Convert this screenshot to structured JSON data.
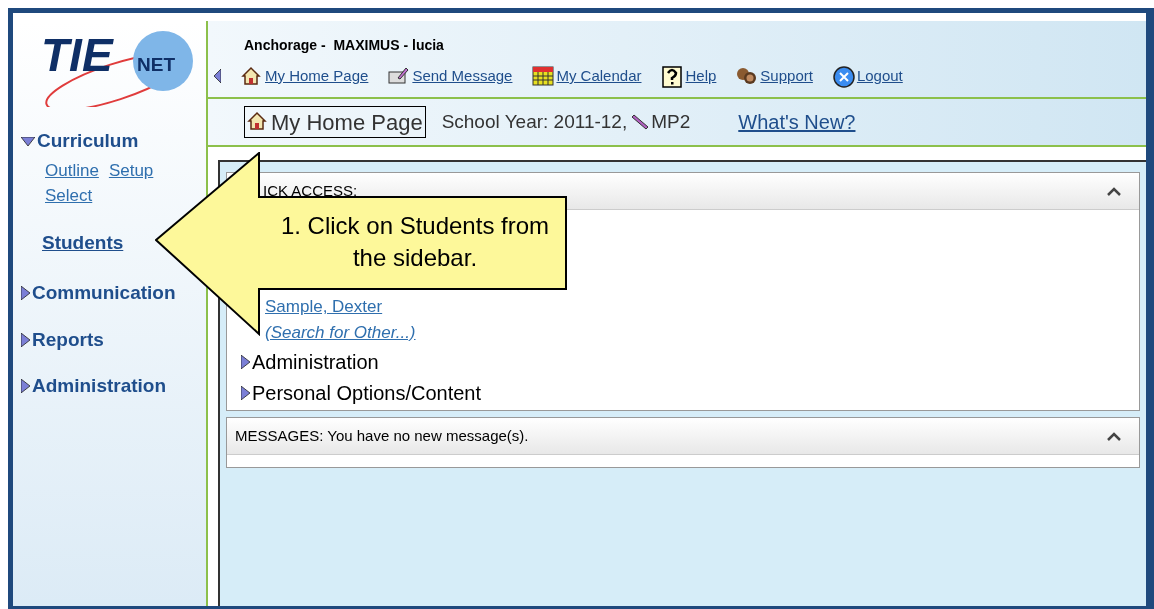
{
  "logo": {
    "word": "TIE",
    "badge": "NET"
  },
  "header": {
    "title": "Anchorage -  MAXIMUS - lucia",
    "nav": [
      {
        "kind": "home",
        "label": "My Home Page"
      },
      {
        "kind": "message",
        "label": "Send Message"
      },
      {
        "kind": "calendar",
        "label": "My Calendar"
      },
      {
        "kind": "help",
        "label": "Help"
      },
      {
        "kind": "support",
        "label": "Support"
      },
      {
        "kind": "logout",
        "label": "Logout"
      }
    ]
  },
  "subheader": {
    "page_button": "My Home Page",
    "school_year": "School Year: 2011-12,",
    "period": "MP2",
    "whats_new": "What's New?"
  },
  "sidebar": {
    "items": [
      {
        "kind": "section",
        "label": "Curriculum",
        "expanded": true,
        "children": [
          {
            "label": "Outline"
          },
          {
            "label": "Setup"
          },
          {
            "label": "Select"
          }
        ]
      },
      {
        "kind": "link",
        "label": "Students"
      },
      {
        "kind": "section",
        "label": "Communication",
        "expanded": false
      },
      {
        "kind": "section",
        "label": "Reports",
        "expanded": false
      },
      {
        "kind": "section",
        "label": "Administration",
        "expanded": false
      }
    ]
  },
  "quick_access": {
    "title": "ICK ACCESS:",
    "links": [
      "Sample, Dexter",
      "(Search for Other...)"
    ],
    "sections": [
      {
        "label": "Administration",
        "expanded": false
      },
      {
        "label": "Personal Options/Content",
        "expanded": false
      }
    ]
  },
  "messages": {
    "title": "MESSAGES: You have no new message(s)."
  },
  "callout": {
    "text": "1. Click on Students from the sidebar."
  }
}
